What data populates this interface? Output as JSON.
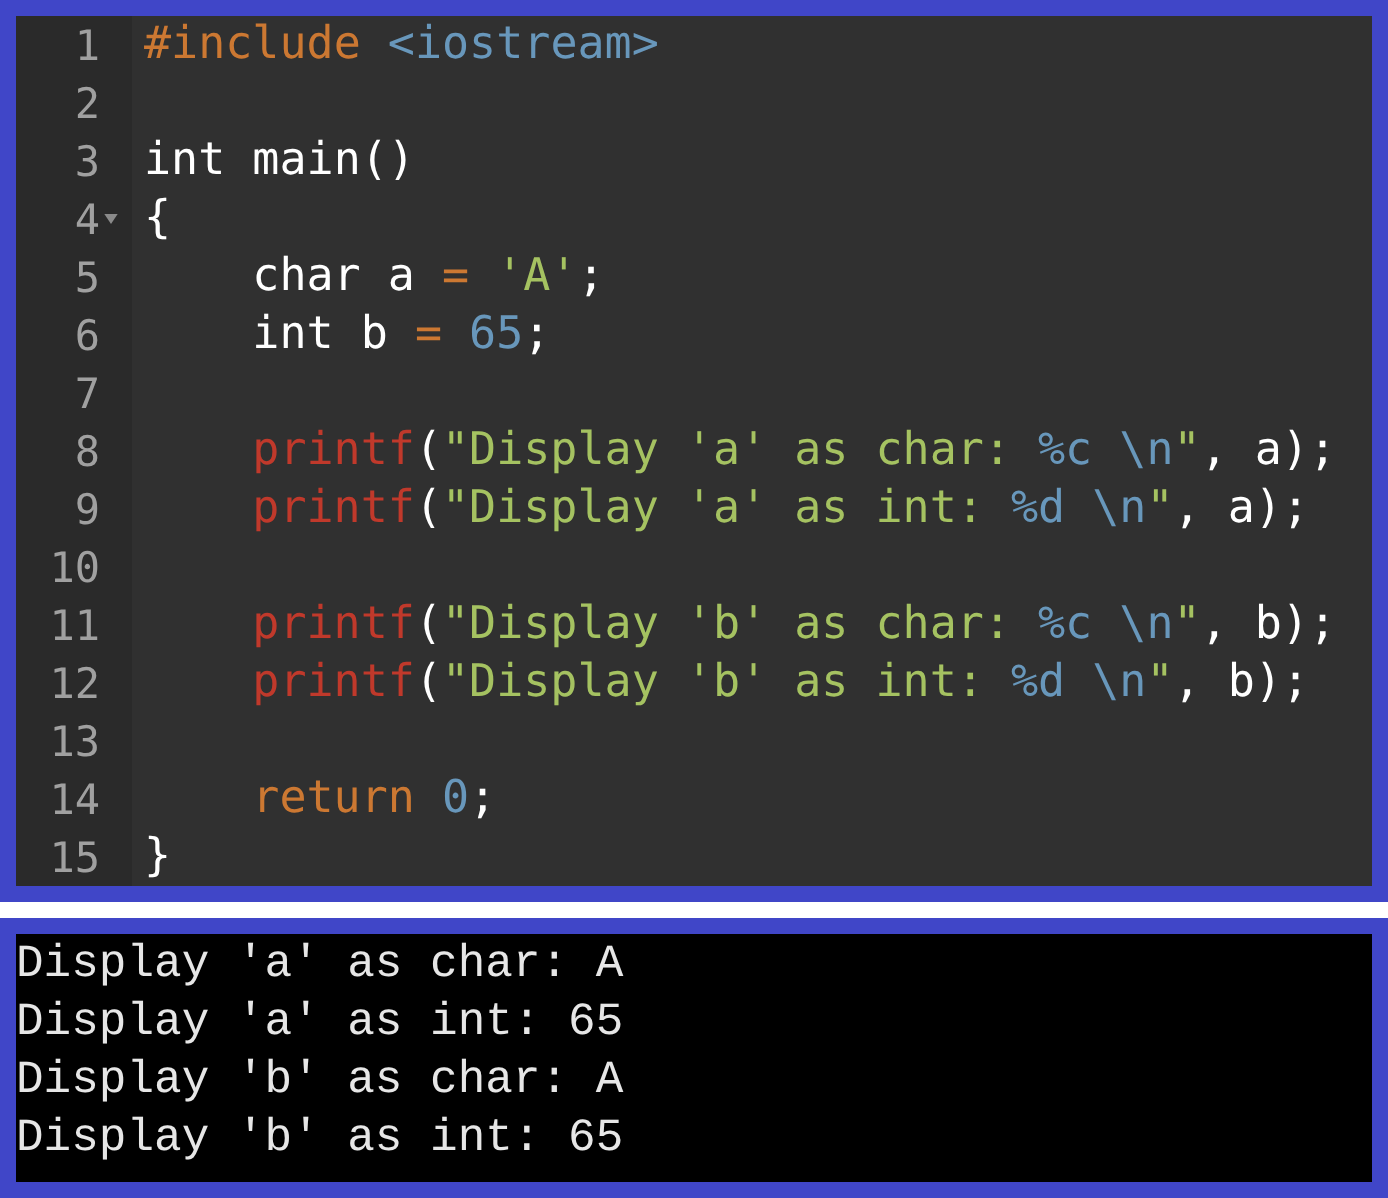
{
  "editor": {
    "lines": [
      {
        "number": "1",
        "foldable": false,
        "indent": false,
        "tokens": [
          {
            "text": "#include",
            "kind": "directive"
          },
          {
            "text": " <iostream>",
            "kind": "header"
          }
        ]
      },
      {
        "number": "2",
        "foldable": false
      },
      {
        "number": "3",
        "foldable": false,
        "indent": false,
        "tokens": [
          {
            "text": "int main()",
            "kind": "plain"
          }
        ]
      },
      {
        "number": "4",
        "foldable": true,
        "indent": false,
        "tokens": [
          {
            "text": "{",
            "kind": "plain"
          }
        ]
      },
      {
        "number": "5",
        "foldable": false,
        "indent": true,
        "tokens": [
          {
            "text": "char a ",
            "kind": "plain"
          },
          {
            "text": "=",
            "kind": "operator"
          },
          {
            "text": " 'A'",
            "kind": "string"
          },
          {
            "text": ";",
            "kind": "plain"
          }
        ]
      },
      {
        "number": "6",
        "foldable": false,
        "indent": true,
        "tokens": [
          {
            "text": "int b ",
            "kind": "plain"
          },
          {
            "text": "=",
            "kind": "operator"
          },
          {
            "text": " 65",
            "kind": "number"
          },
          {
            "text": ";",
            "kind": "plain"
          }
        ]
      },
      {
        "number": "7",
        "foldable": false
      },
      {
        "number": "8",
        "foldable": false,
        "indent": true,
        "tokens": [
          {
            "text": "printf",
            "kind": "function"
          },
          {
            "text": "(",
            "kind": "plain"
          },
          {
            "text": "\"Display 'a' as char: ",
            "kind": "string"
          },
          {
            "text": "%c \\n",
            "kind": "escape"
          },
          {
            "text": "\"",
            "kind": "string"
          },
          {
            "text": ", a);",
            "kind": "plain"
          }
        ]
      },
      {
        "number": "9",
        "foldable": false,
        "indent": true,
        "tokens": [
          {
            "text": "printf",
            "kind": "function"
          },
          {
            "text": "(",
            "kind": "plain"
          },
          {
            "text": "\"Display 'a' as int: ",
            "kind": "string"
          },
          {
            "text": "%d \\n",
            "kind": "escape"
          },
          {
            "text": "\"",
            "kind": "string"
          },
          {
            "text": ", a);",
            "kind": "plain"
          }
        ]
      },
      {
        "number": "10",
        "foldable": false
      },
      {
        "number": "11",
        "foldable": false,
        "indent": true,
        "tokens": [
          {
            "text": "printf",
            "kind": "function"
          },
          {
            "text": "(",
            "kind": "plain"
          },
          {
            "text": "\"Display 'b' as char: ",
            "kind": "string"
          },
          {
            "text": "%c \\n",
            "kind": "escape"
          },
          {
            "text": "\"",
            "kind": "string"
          },
          {
            "text": ", b);",
            "kind": "plain"
          }
        ]
      },
      {
        "number": "12",
        "foldable": false,
        "indent": true,
        "tokens": [
          {
            "text": "printf",
            "kind": "function"
          },
          {
            "text": "(",
            "kind": "plain"
          },
          {
            "text": "\"Display 'b' as int: ",
            "kind": "string"
          },
          {
            "text": "%d \\n",
            "kind": "escape"
          },
          {
            "text": "\"",
            "kind": "string"
          },
          {
            "text": ", b);",
            "kind": "plain"
          }
        ]
      },
      {
        "number": "13",
        "foldable": false
      },
      {
        "number": "14",
        "foldable": false,
        "indent": true,
        "tokens": [
          {
            "text": "return",
            "kind": "keyword"
          },
          {
            "text": " 0",
            "kind": "number"
          },
          {
            "text": ";",
            "kind": "plain"
          }
        ]
      },
      {
        "number": "15",
        "foldable": false,
        "indent": false,
        "tokens": [
          {
            "text": "}",
            "kind": "plain"
          }
        ]
      }
    ]
  },
  "console": {
    "lines": [
      "Display 'a' as char: A",
      "Display 'a' as int: 65",
      "Display 'b' as char: A",
      "Display 'b' as int: 65"
    ]
  }
}
